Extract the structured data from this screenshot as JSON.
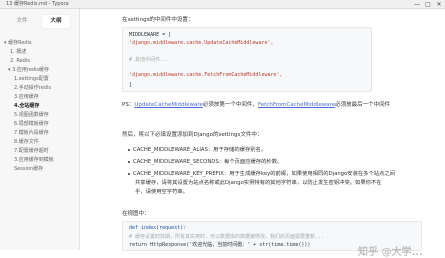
{
  "window": {
    "title": "13 缓存Redis.md - Typora",
    "controls": [
      "—",
      "□",
      "✕"
    ]
  },
  "sidebar": {
    "tabs": [
      {
        "label": "文件",
        "active": false
      },
      {
        "label": "大纲",
        "active": true
      }
    ],
    "items": [
      {
        "label": "▾ 缓存Redis",
        "indent": 0,
        "active": false
      },
      {
        "label": "1. 概述",
        "indent": 1,
        "active": false
      },
      {
        "label": "2. Redis",
        "indent": 1,
        "active": false
      },
      {
        "label": "▾ 3.应用redis缓存",
        "indent": 1,
        "active": false
      },
      {
        "label": "1.settings配置",
        "indent": 2,
        "active": false
      },
      {
        "label": "2.手动操作redis",
        "indent": 2,
        "active": false
      },
      {
        "label": "3.应用缓存",
        "indent": 2,
        "active": false
      },
      {
        "label": "4.全站缓存",
        "indent": 2,
        "active": true
      },
      {
        "label": "5.视图函数缓存",
        "indent": 2,
        "active": false
      },
      {
        "label": "6.局部模板缓存",
        "indent": 2,
        "active": false
      },
      {
        "label": "7.模板片段缓存",
        "indent": 2,
        "active": false
      },
      {
        "label": "8.缓存文件",
        "indent": 2,
        "active": false
      },
      {
        "label": "7.配置缓存超时",
        "indent": 2,
        "active": false
      },
      {
        "label": "3.应用缓存到模板",
        "indent": 2,
        "active": false
      },
      {
        "label": "Session缓存",
        "indent": 2,
        "active": false
      }
    ]
  },
  "doc": {
    "intro": "在settings的中间件中设置：",
    "code1": [
      "MIDDLEWARE = [",
      "    'django.middleware.cache.UpdateCacheMiddleware',",
      "",
      "    # 其他中间件...",
      "",
      "    'django.middleware.cache.FetchFromCacheMiddleware',",
      "]"
    ],
    "ps_prefix": "PS：",
    "ps_link1": "UpdateCacheMiddleware",
    "ps_mid": "必须放第一个中间件，",
    "ps_link2": "FetchFromCacheMiddleware",
    "ps_suffix": "必须放最后一个中间件",
    "then": "然后，将以下必填设置添加到Django的settings文件中：",
    "bullets": [
      "CACHE_MIDDLEWARE_ALIAS：用于存储的缓存别名。",
      "CACHE_MIDDLEWARE_SECONDS：每个页面应缓存的秒数。",
      "CACHE_MIDDLEWARE_KEY_PREFIX：用于生成缓存key的前缀，如果使用相同的Django安装在多个站点之间",
      "共享缓存，请将其设置为站点名称或此Django实例特有的其他字符串，以防止发生密钥冲突。如果你不在",
      "乎，请使用空字符串。"
    ],
    "view_heading": "在视图中：",
    "code2": [
      "def index(request):",
      "    # 缓存设置时效期，所有其实用时，可以数据库的数据被修改，我们的页面需要重新...",
      "    return HttpResponse('欢迎光临，当前时间戳：' + str(time.time()))"
    ],
    "watermark": "知乎 @大学..."
  }
}
